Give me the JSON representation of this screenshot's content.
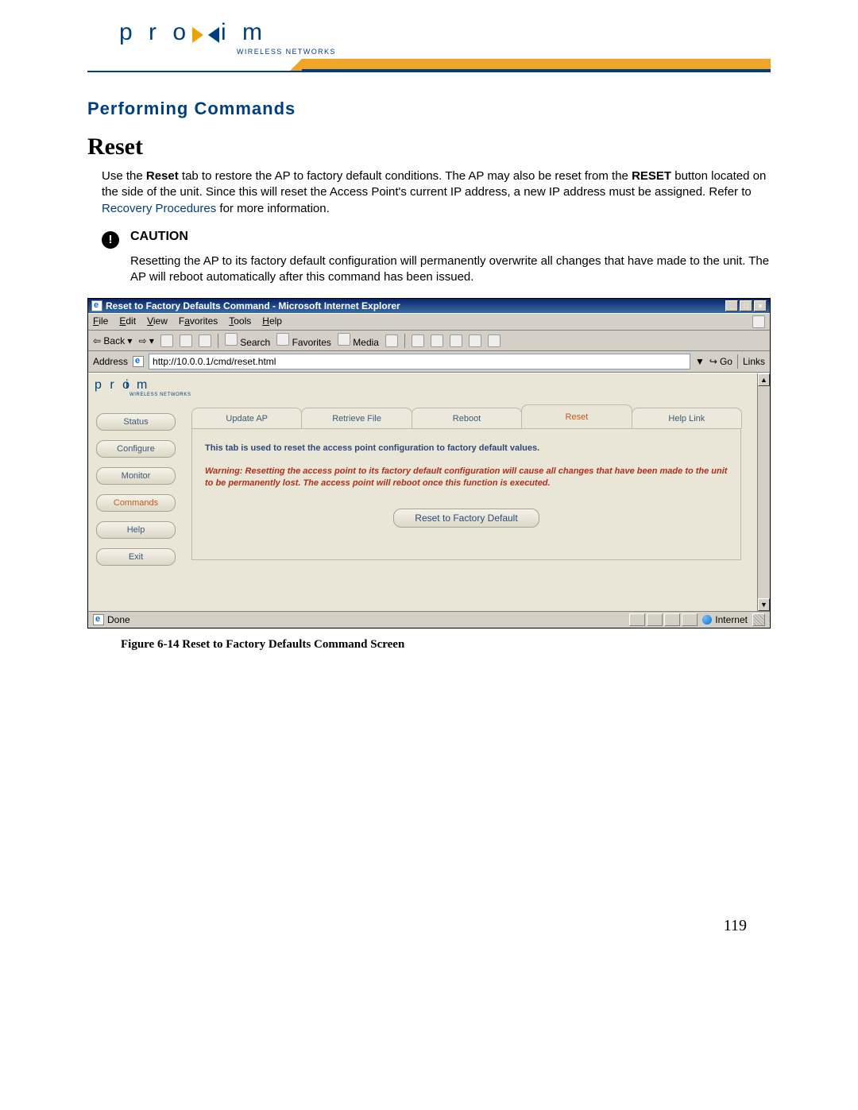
{
  "header": {
    "logo_text_left": "p r o",
    "logo_text_right": "i m",
    "logo_sub": "WIRELESS NETWORKS"
  },
  "section_title": "Performing Commands",
  "heading": "Reset",
  "intro_prefix": "Use the ",
  "intro_bold1": "Reset",
  "intro_mid1": " tab to restore the AP to factory default conditions. The AP may also be reset from the ",
  "intro_bold2": "RESET",
  "intro_mid2": " button located on the side of the unit. Since this will reset the Access Point's current IP address, a new IP address must be assigned. Refer to ",
  "intro_link": "Recovery Procedures",
  "intro_end": " for more information.",
  "caution": {
    "label": "CAUTION",
    "text": "Resetting the AP to its factory default configuration will permanently overwrite all changes that have made to the unit. The AP will reboot automatically after this command has been issued."
  },
  "ie": {
    "title": "Reset to Factory Defaults Command - Microsoft Internet Explorer",
    "menu": [
      "File",
      "Edit",
      "View",
      "Favorites",
      "Tools",
      "Help"
    ],
    "toolbar": {
      "back": "Back",
      "search": "Search",
      "favorites": "Favorites",
      "media": "Media"
    },
    "address_label": "Address",
    "url": "http://10.0.0.1/cmd/reset.html",
    "go": "Go",
    "links": "Links",
    "status_done": "Done",
    "status_zone": "Internet"
  },
  "ap": {
    "sidebar": [
      "Status",
      "Configure",
      "Monitor",
      "Commands",
      "Help",
      "Exit"
    ],
    "tabs": [
      "Update AP",
      "Retrieve File",
      "Reboot",
      "Reset",
      "Help Link"
    ],
    "msg1": "This tab is used to reset the access point configuration to factory default values.",
    "msg2": "Warning: Resetting the access point to its factory default configuration will cause all changes that have been made to the unit to be permanently lost. The access point will reboot once this function is executed.",
    "reset_btn": "Reset to Factory Default"
  },
  "figure_caption": "Figure 6-14    Reset to Factory Defaults Command Screen",
  "page_number": "119"
}
